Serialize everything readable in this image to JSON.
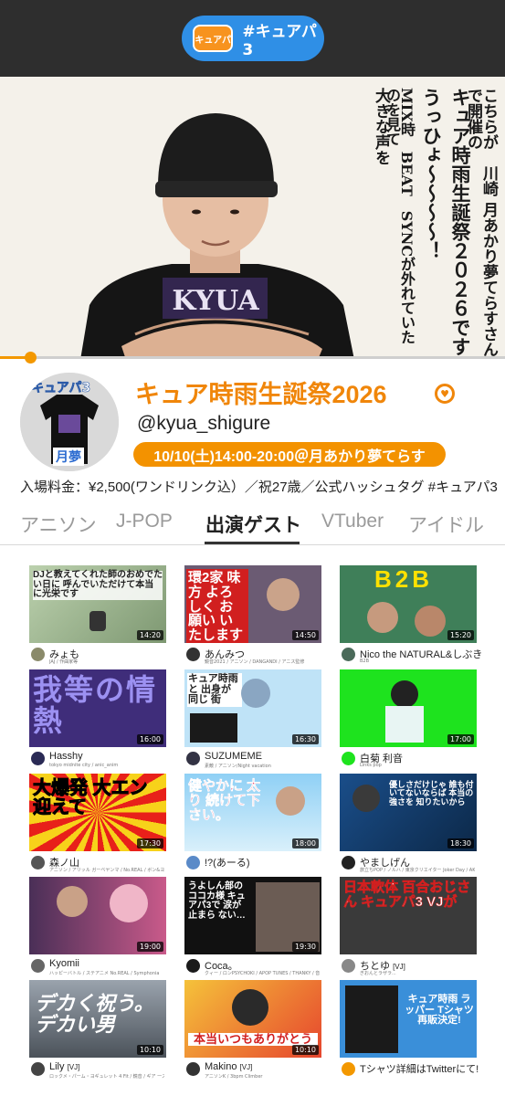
{
  "header": {
    "logo_text": "キュアパ",
    "hashtag": "#キュアパ3"
  },
  "hero": {
    "columns": [
      "こちらが　川崎 月あかり夢てらすさんで開催の",
      "キュア時雨生誕祭２０２６です",
      "うっひょ～～～～！",
      "MIX時　BEAT　SYNCが外れていたのを見て",
      "大きな声を"
    ],
    "shirt_text": "KYUA",
    "progress": 0.06
  },
  "profile": {
    "avatar_label_top": "キュアパ3",
    "avatar_label_bottom": "月夢",
    "title": "キュア時雨生誕祭2026",
    "handle": "@kyua_shigure",
    "datetime": "10/10(土)14:00-20:00＠月あかり夢てらす",
    "info_text": "入場料金：¥2,500(ワンドリンク込）／祝27歳／公式ハッシュタグ ",
    "info_tag": "#キュアパ3"
  },
  "tabs": [
    "アニソン",
    "J-POP",
    "出演ゲスト",
    "VTuber",
    "アイドル"
  ],
  "active_tab": 2,
  "cards": [
    {
      "name": "みょも",
      "vj": "",
      "sub": "JAJ / 作曲家等",
      "duration": "14:20",
      "thumb_text": "DJと教えてくれた師のおめでたい日に 呼んでいただけて本当に光栄です"
    },
    {
      "name": "あんみつ",
      "vj": "",
      "sub": "鏡音2021 / アニソン / DANGANDI / アニス監修",
      "duration": "14:50",
      "thumb_text": "環2家 味方 よろしく お願い いたします"
    },
    {
      "name": "Nico the NATURAL&しぶき",
      "vj": "",
      "sub": "B2B",
      "duration": "15:20",
      "thumb_text": "B2B"
    },
    {
      "name": "Hasshy",
      "vj": "",
      "sub": "tokyo midnite city / anic_anim",
      "duration": "16:00",
      "thumb_text": "我等の情熱"
    },
    {
      "name": "SUZUMEME",
      "vj": "",
      "sub": "素敵 / アニソン/Night vacation",
      "duration": "16:30",
      "thumb_text": "キュア時雨と 出身が 同じ 街"
    },
    {
      "name": "白菊 利音",
      "vj": "",
      "sub": "Links pop",
      "duration": "17:00",
      "thumb_text": ""
    },
    {
      "name": "森ノ山",
      "vj": "",
      "sub": "アニソン / アリッル ガーベヤンマ / No.REAL / ボン&ヨセ",
      "duration": "17:30",
      "thumb_text": "大爆発 大エン 迎えて"
    },
    {
      "name": "!?(あーる)",
      "vj": "",
      "sub": "",
      "duration": "18:00",
      "thumb_text": "健やかに 太り 続けて下さい。"
    },
    {
      "name": "やましげん",
      "vj": "",
      "sub": "旅立ちPOP / ノルハ / 東京クリエイター Joker Day / AKIBA-POP CLUB",
      "duration": "18:30",
      "thumb_text": "優しさだけじゃ 誰も付いてないならば 本当の強さを 知りたいから"
    },
    {
      "name": "Kyomii",
      "vj": "",
      "sub": "ハッピーバトル / ステアニメ No.REAL / Symphonia",
      "duration": "19:00",
      "thumb_text": ""
    },
    {
      "name": "Coca。",
      "vj": "",
      "sub": "クィー / ロンPSYCHOKI / APOP TUNES / THANKY / 音楽作家 / GLITTER",
      "duration": "19:30",
      "thumb_text": "うよしん部のココカ様 キュアパ3で 涙が止まら ない…"
    },
    {
      "name": "ちとゆ",
      "vj": "[VJ]",
      "sub": "ぎおんとラザラ...",
      "duration": "",
      "thumb_text": "日本軟体 百合おじさん キュアパ3 VJが"
    },
    {
      "name": "Lily",
      "vj": "[VJ]",
      "sub": "ロックメ・パーム・ヨギュレット 4 Fit / 鏡音 / ギア 一ステア一周",
      "duration": "10:10",
      "thumb_text": "デカく祝う。 デカい男"
    },
    {
      "name": "Makino",
      "vj": "[VJ]",
      "sub": "アニソンK / 3bpm Climber",
      "duration": "10:10",
      "thumb_text": "本当いつもありがとう"
    },
    {
      "name": "Tシャツ詳細はTwitterにて!",
      "vj": "",
      "sub": "",
      "duration": "",
      "thumb_text": "キュア時雨 ラッパー Tシャツ 再販決定!"
    }
  ]
}
